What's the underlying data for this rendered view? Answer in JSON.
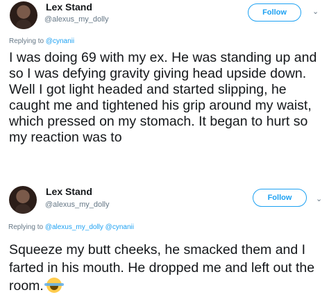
{
  "tweets": [
    {
      "display_name": "Lex Stand",
      "handle": "@alexus_my_dolly",
      "follow_label": "Follow",
      "replying_to_label": "Replying to",
      "mentions": [
        "@cynanii"
      ],
      "text": "I was doing 69 with my ex. He was standing up and so I was defying gravity giving head upside down. Well I got light headed and started slipping, he caught me and tightened his grip around my waist, which pressed on my stomach. It began to hurt so my reaction was to"
    },
    {
      "display_name": "Lex Stand",
      "handle": "@alexus_my_dolly",
      "follow_label": "Follow",
      "replying_to_label": "Replying to",
      "mentions": [
        "@alexus_my_dolly",
        "@cynanii"
      ],
      "text": "Squeeze my butt cheeks, he smacked them and I farted in his mouth. He dropped me and left out the room.",
      "emoji": "face-with-tears-of-joy"
    }
  ],
  "icons": {
    "chevron": "chevron-down-icon",
    "emoji": "tears-of-joy-emoji-icon"
  },
  "colors": {
    "accent": "#1da1f2",
    "secondary_text": "#657786",
    "primary_text": "#14171a"
  }
}
